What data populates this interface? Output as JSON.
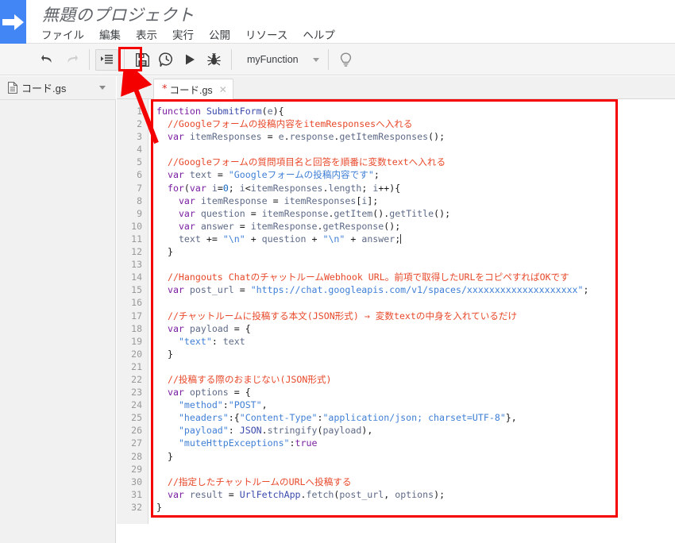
{
  "header": {
    "logo_icon": "blue-arrow-logo",
    "project_title": "無題のプロジェクト",
    "menu": [
      {
        "label": "ファイル"
      },
      {
        "label": "編集"
      },
      {
        "label": "表示"
      },
      {
        "label": "実行"
      },
      {
        "label": "公開"
      },
      {
        "label": "リソース"
      },
      {
        "label": "ヘルプ"
      }
    ]
  },
  "toolbar": {
    "undo_icon": "undo-arrow-icon",
    "redo_icon": "redo-arrow-icon",
    "indent_icon": "indent-lines-icon",
    "save_icon": "save-floppy-disk-icon",
    "history_icon": "clock-history-icon",
    "run_icon": "run-play-icon",
    "debug_icon": "debug-bug-icon",
    "function_name": "myFunction",
    "function_caret_icon": "chevron-down-icon",
    "hint_icon": "lightbulb-icon"
  },
  "sidebar": {
    "file_icon": "document-file-icon",
    "file_name": "コード.gs",
    "file_caret_icon": "chevron-down-icon"
  },
  "editor": {
    "tab_modified_marker": "*",
    "tab_label": "コード.gs",
    "tab_close_icon": "close-x-icon",
    "line_numbers": [
      1,
      2,
      3,
      4,
      5,
      6,
      7,
      8,
      9,
      10,
      11,
      12,
      13,
      14,
      15,
      16,
      17,
      18,
      19,
      20,
      21,
      22,
      23,
      24,
      25,
      26,
      27,
      28,
      29,
      30,
      31,
      32
    ],
    "code_lines": [
      "function SubmitForm(e){",
      "  //Googleフォームの投稿内容をitemResponsesへ入れる",
      "  var itemResponses = e.response.getItemResponses();",
      "",
      "  //Googleフォームの質問項目名と回答を順番に変数textへ入れる",
      "  var text = \"Googleフォームの投稿内容です\";",
      "  for(var i=0; i<itemResponses.length; i++){",
      "    var itemResponse = itemResponses[i];",
      "    var question = itemResponse.getItem().getTitle();",
      "    var answer = itemResponse.getResponse();",
      "    text += \"\\n\" + question + \"\\n\" + answer;",
      "  }",
      "",
      "  //Hangouts ChatのチャットルームWebhook URL。前項で取得したURLをコピペすればOKです",
      "  var post_url = \"https://chat.googleapis.com/v1/spaces/xxxxxxxxxxxxxxxxxxxx\";",
      "",
      "  //チャットルームに投稿する本文(JSON形式) → 変数textの中身を入れているだけ",
      "  var payload = {",
      "    \"text\": text",
      "  }",
      "",
      "  //投稿する際のおまじない(JSON形式)",
      "  var options = {",
      "    \"method\":\"POST\",",
      "    \"headers\":{\"Content-Type\":\"application/json; charset=UTF-8\"},",
      "    \"payload\": JSON.stringify(payload),",
      "    \"muteHttpExceptions\":true",
      "  }",
      "",
      "  //指定したチャットルームのURLへ投稿する",
      "  var result = UrlFetchApp.fetch(post_url, options);",
      "}"
    ]
  },
  "annotations": {
    "highlight_color": "#f50000",
    "save_button_highlight": "save-button-red-box",
    "code_area_highlight": "code-area-red-box",
    "pointer_arrow": "red-arrow-pointing-to-save-button"
  },
  "colors": {
    "brand_blue": "#4285f4",
    "annotation_red": "#f50000",
    "toolbar_bg": "#f5f5f5",
    "sidebar_bg": "#f1f1f1",
    "keyword": "#7b1fa2",
    "string": "#3f7fd6",
    "comment": "#e8492b"
  }
}
